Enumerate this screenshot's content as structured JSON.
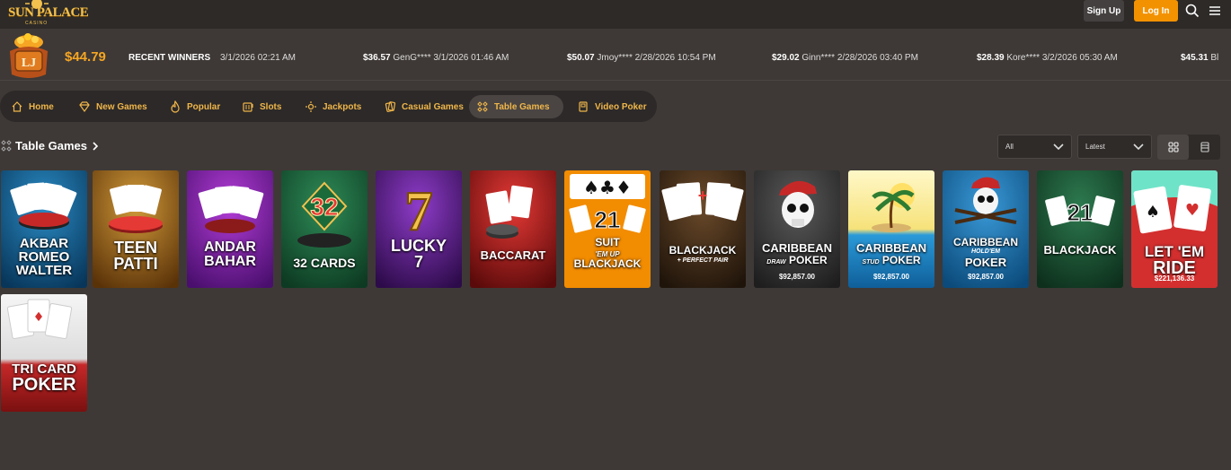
{
  "header": {
    "logo_text": "SUN PALACE",
    "logo_sub": "CASINO",
    "signup_label": "Sign Up",
    "login_label": "Log In"
  },
  "jackpot_badge_text": "LJ",
  "balance": "$44.79",
  "recent_winners": {
    "label": "RECENT WINNERS",
    "first_time": "3/1/2026 02:21 AM",
    "entries": [
      {
        "amount": "$36.57",
        "detail": "GenG**** 3/1/2026 01:46 AM"
      },
      {
        "amount": "$50.07",
        "detail": "Jmoy**** 2/28/2026 10:54 PM"
      },
      {
        "amount": "$29.02",
        "detail": "Ginn**** 2/28/2026 03:40 PM"
      },
      {
        "amount": "$28.39",
        "detail": "Kore**** 3/2/2026 05:30 AM"
      },
      {
        "amount": "$45.31",
        "detail": "Bl"
      }
    ]
  },
  "nav": {
    "items": [
      {
        "label": "Home"
      },
      {
        "label": "New Games"
      },
      {
        "label": "Popular"
      },
      {
        "label": "Slots"
      },
      {
        "label": "Jackpots"
      },
      {
        "label": "Casual Games"
      },
      {
        "label": "Table Games"
      },
      {
        "label": "Video Poker"
      }
    ],
    "active": "Table Games"
  },
  "section": {
    "title": "Table Games",
    "filter_value": "All",
    "sort_value": "Latest"
  },
  "games": [
    {
      "line1": "AKBAR",
      "line2": "ROMEO",
      "line3": "WALTER",
      "bg": "#0e5b8a"
    },
    {
      "line1": "TEEN",
      "line2": "PATTI",
      "bg": "#8a5a10"
    },
    {
      "line1": "ANDAR",
      "line2": "BAHAR",
      "bg": "#7b1fa2"
    },
    {
      "line1": "32 CARDS",
      "bg": "#1b5e3a"
    },
    {
      "line1": "LUCKY",
      "line2": "7",
      "bg": "#5a1f8a"
    },
    {
      "line1": "BACCARAT",
      "bg": "#a01818"
    },
    {
      "line1": "SUIT",
      "line2": "'EM UP",
      "line3": "BLACKJACK",
      "bg": "#f28c00"
    },
    {
      "line1": "BLACKJACK",
      "sub": "+ PERFECT PAIR",
      "bg": "#3a2a1a"
    },
    {
      "line1": "CARIBBEAN",
      "sub": "DRAW",
      "line2": "POKER",
      "jackpot": "$92,857.00",
      "bg": "#3a3a3a"
    },
    {
      "line1": "CARIBBEAN",
      "sub": "STUD",
      "line2": "POKER",
      "jackpot": "$92,857.00",
      "bg": "#2a7fb8"
    },
    {
      "line1": "CARIBBEAN",
      "sub": "HOLD'EM",
      "line2": "POKER",
      "jackpot": "$92,857.00",
      "bg": "#1e6aa0"
    },
    {
      "line1": "BLACKJACK",
      "bg": "#1b4d33"
    },
    {
      "line1": "LET 'EM",
      "line2": "RIDE",
      "jackpot": "$221,136.33",
      "bg": "#d32f2f"
    },
    {
      "line1": "TRI CARD",
      "line2": "POKER",
      "bg": "#b71c1c"
    }
  ]
}
